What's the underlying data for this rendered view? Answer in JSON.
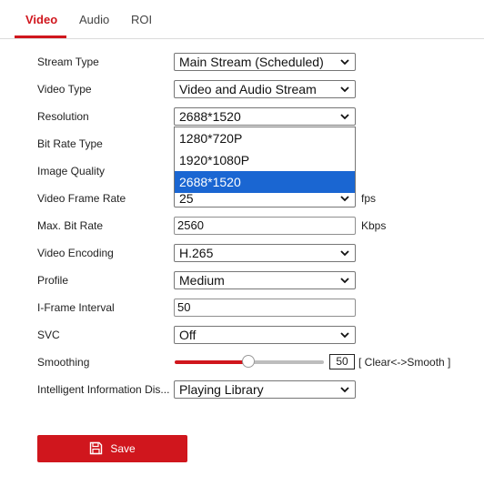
{
  "tabs": [
    {
      "label": "Video",
      "active": true
    },
    {
      "label": "Audio",
      "active": false
    },
    {
      "label": "ROI",
      "active": false
    }
  ],
  "form": {
    "stream_type": {
      "label": "Stream Type",
      "value": "Main Stream (Scheduled)"
    },
    "video_type": {
      "label": "Video Type",
      "value": "Video and Audio Stream"
    },
    "resolution": {
      "label": "Resolution",
      "value": "2688*1520",
      "options": [
        "1280*720P",
        "1920*1080P",
        "2688*1520"
      ],
      "selected_option": "2688*1520"
    },
    "bit_rate_type": {
      "label": "Bit Rate Type"
    },
    "image_quality": {
      "label": "Image Quality"
    },
    "frame_rate": {
      "label": "Video Frame Rate",
      "value": "25",
      "unit": "fps"
    },
    "max_bit_rate": {
      "label": "Max. Bit Rate",
      "value": "2560",
      "unit": "Kbps"
    },
    "video_encoding": {
      "label": "Video Encoding",
      "value": "H.265"
    },
    "profile": {
      "label": "Profile",
      "value": "Medium"
    },
    "iframe_interval": {
      "label": "I-Frame Interval",
      "value": "50"
    },
    "svc": {
      "label": "SVC",
      "value": "Off"
    },
    "smoothing": {
      "label": "Smoothing",
      "value": "50",
      "level": 0.5,
      "hint": "[ Clear<->Smooth ]"
    },
    "intelligent_info": {
      "label": "Intelligent Information Dis...",
      "value": "Playing Library"
    }
  },
  "actions": {
    "save_label": "Save"
  },
  "colors": {
    "accent": "#d0161d",
    "selection": "#1a66d2"
  }
}
